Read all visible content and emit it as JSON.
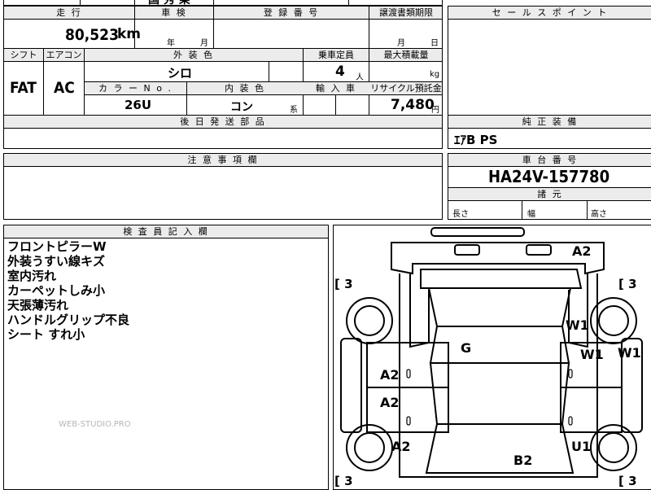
{
  "sheet": {
    "top_cut_text": "国 秀 乗",
    "mileage_header": "走 行",
    "mileage": "80,523",
    "mileage_unit": "km",
    "shaken_header": "車 検",
    "shaken_year": "年",
    "shaken_month": "月",
    "reg_header": "登 録 番 号",
    "transfer_header": "譲渡書類期限",
    "transfer_month": "月",
    "transfer_day": "日",
    "shift_header": "シフト",
    "shift": "FAT",
    "ac_header": "エアコン",
    "ac": "AC",
    "exterior_color_header": "外 装 色",
    "exterior_color": "シロ",
    "capacity_header": "乗車定員",
    "capacity": "4",
    "capacity_unit": "人",
    "max_load_header": "最大積載量",
    "max_load_unit": "kg",
    "color_no_header": "カ ラ ー N o .",
    "color_no": "26U",
    "interior_header": "内 装 色",
    "interior": "コン",
    "interior_suffix": "系",
    "import_header": "輸 入 車",
    "recycle_header": "リサイクル預託金",
    "recycle_fee": "7,480",
    "recycle_unit": "円",
    "later_parts_header": "後 日 発 送 部 品",
    "caution_header": "注 意 事 項 欄",
    "inspector_header": "検 査 員 記 入 欄",
    "inspector_notes": [
      "フロントピラーW",
      "外装うすい線キズ",
      "室内汚れ",
      "カーペットしみ小",
      "天張薄汚れ",
      "ハンドルグリップ不良",
      "シート すれ小"
    ],
    "watermark": "WEB-STUDIO.PRO"
  },
  "right": {
    "sales_header": "セ ー ル ス ポ イ ン ト",
    "equipment_header": "純 正 装 備",
    "equipment": "ｴｱB PS",
    "chassis_header": "車 台 番 号",
    "chassis": "HA24V-157780",
    "dims_header": "諸 元",
    "length": "長さ",
    "width": "幅",
    "height": "高さ"
  },
  "diagram": {
    "tire_fl": "3",
    "tire_fr": "3",
    "tire_rl": "3",
    "tire_rr": "3",
    "marks": {
      "front_right_fender": "A2",
      "fr_door_upper": "W1",
      "fr_door": "W1",
      "fr_side": "W1",
      "roof": "G",
      "left_front_door": "A2",
      "left_rear_door": "A2",
      "left_rear_quarter": "A2",
      "rear_right_quarter": "U1",
      "rear": "B2"
    }
  }
}
